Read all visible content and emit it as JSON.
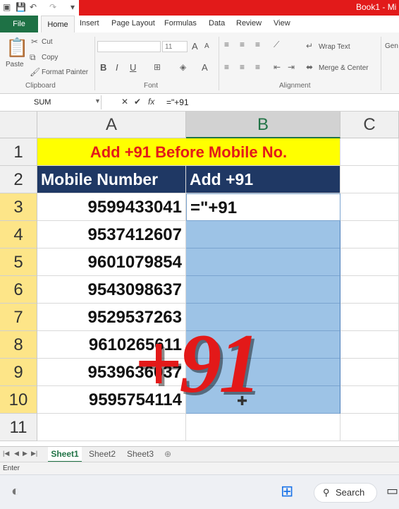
{
  "title_bar": {
    "workbook": "Book1 - Mi",
    "save_icon": "save-icon",
    "undo_icon": "undo-icon",
    "redo_icon": "redo-icon",
    "accent_color": "#e21a1a"
  },
  "ribbon_tabs": [
    "File",
    "Home",
    "Insert",
    "Page Layout",
    "Formulas",
    "Data",
    "Review",
    "View"
  ],
  "clipboard": {
    "paste": "Paste",
    "cut": "Cut",
    "copy": "Copy",
    "format_painter": "Format Painter",
    "label": "Clipboard"
  },
  "font": {
    "name": "",
    "size": "11",
    "grow": "A",
    "shrink": "A",
    "bold": "B",
    "italic": "I",
    "underline": "U",
    "font_color": "A",
    "label": "Font"
  },
  "alignment": {
    "wrap_text": "Wrap Text",
    "merge_center": "Merge & Center",
    "label": "Alignment"
  },
  "number_group": {
    "format": "Gen"
  },
  "formula_bar": {
    "name_box": "SUM",
    "cancel": "✕",
    "enter": "✔",
    "fx": "fx",
    "formula": "=\"+91"
  },
  "columns": [
    "A",
    "B",
    "C"
  ],
  "rows": [
    "1",
    "2",
    "3",
    "4",
    "5",
    "6",
    "7",
    "8",
    "9",
    "10",
    "11"
  ],
  "sheet": {
    "title": "Add +91 Before Mobile No.",
    "header_a": "Mobile Number",
    "header_b": "Add +91",
    "numbers": [
      "9599433041",
      "9537412607",
      "9601079854",
      "9543098637",
      "9529537263",
      "9610265611",
      "9539636037",
      "9595754114"
    ],
    "editing_cell": "=\"+91"
  },
  "overlay_text": "+91",
  "sheet_tabs": [
    "Sheet1",
    "Sheet2",
    "Sheet3"
  ],
  "status": "Enter",
  "taskbar": {
    "search": "Search"
  }
}
